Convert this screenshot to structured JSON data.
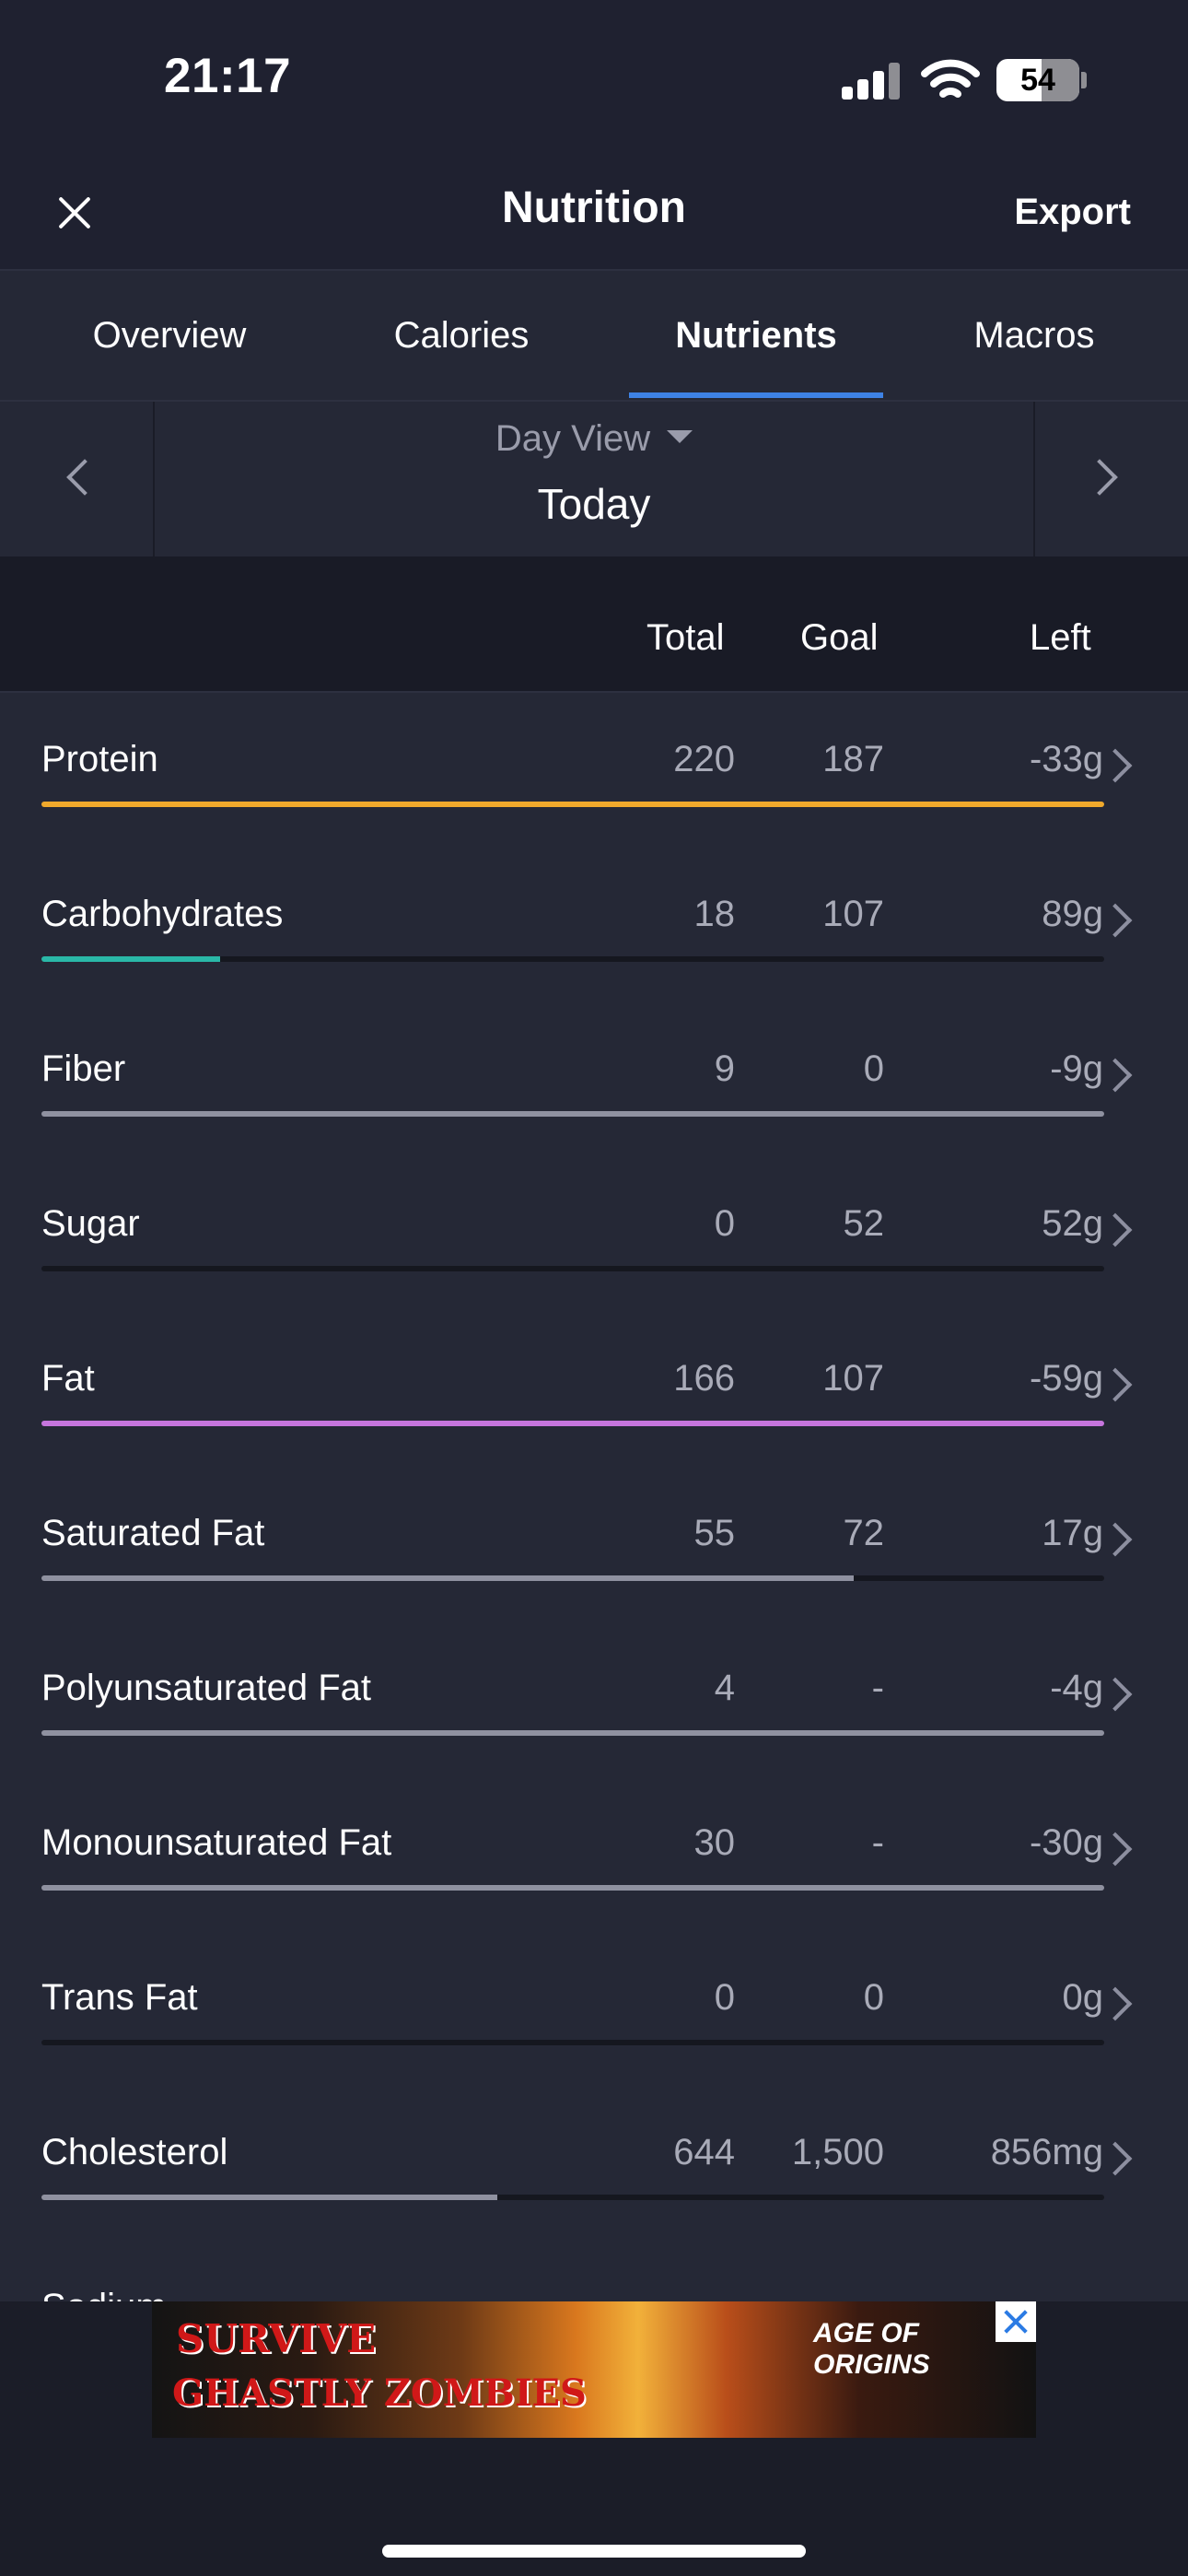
{
  "status_bar": {
    "time": "21:17",
    "battery": "54",
    "battery_level": 0.54
  },
  "header": {
    "title": "Nutrition",
    "export_label": "Export",
    "close_icon": "close-icon"
  },
  "tabs": [
    {
      "label": "Overview",
      "active": false
    },
    {
      "label": "Calories",
      "active": false
    },
    {
      "label": "Nutrients",
      "active": true
    },
    {
      "label": "Macros",
      "active": false
    }
  ],
  "date_nav": {
    "view_label": "Day View",
    "date_label": "Today",
    "prev_icon": "chevron-left-icon",
    "next_icon": "chevron-right-icon"
  },
  "columns": {
    "total": "Total",
    "goal": "Goal",
    "left": "Left"
  },
  "nutrients": [
    {
      "name": "Protein",
      "total": "220",
      "goal": "187",
      "left": "-33g",
      "progress": 1.0,
      "color": "#f0a92c"
    },
    {
      "name": "Carbohydrates",
      "total": "18",
      "goal": "107",
      "left": "89g",
      "progress": 0.168,
      "color": "#2ab8a8"
    },
    {
      "name": "Fiber",
      "total": "9",
      "goal": "0",
      "left": "-9g",
      "progress": 1.0,
      "color": "#8f91a0"
    },
    {
      "name": "Sugar",
      "total": "0",
      "goal": "52",
      "left": "52g",
      "progress": 0.0,
      "color": "#8f91a0"
    },
    {
      "name": "Fat",
      "total": "166",
      "goal": "107",
      "left": "-59g",
      "progress": 1.0,
      "color": "#c675dd"
    },
    {
      "name": "Saturated Fat",
      "total": "55",
      "goal": "72",
      "left": "17g",
      "progress": 0.764,
      "color": "#8f91a0"
    },
    {
      "name": "Polyunsaturated Fat",
      "total": "4",
      "goal": "-",
      "left": "-4g",
      "progress": 1.0,
      "color": "#8f91a0"
    },
    {
      "name": "Monounsaturated Fat",
      "total": "30",
      "goal": "-",
      "left": "-30g",
      "progress": 1.0,
      "color": "#8f91a0"
    },
    {
      "name": "Trans Fat",
      "total": "0",
      "goal": "0",
      "left": "0g",
      "progress": 0.0,
      "color": "#8f91a0"
    },
    {
      "name": "Cholesterol",
      "total": "644",
      "goal": "1,500",
      "left": "856mg",
      "progress": 0.429,
      "color": "#8f91a0"
    }
  ],
  "partial_row": {
    "name": "Sodium"
  },
  "ad": {
    "line1": "SURVIVE",
    "line2": "GHASTLY ZOMBIES",
    "brand": "AGE OF ORIGINS",
    "close_icon": "ad-close-icon"
  }
}
